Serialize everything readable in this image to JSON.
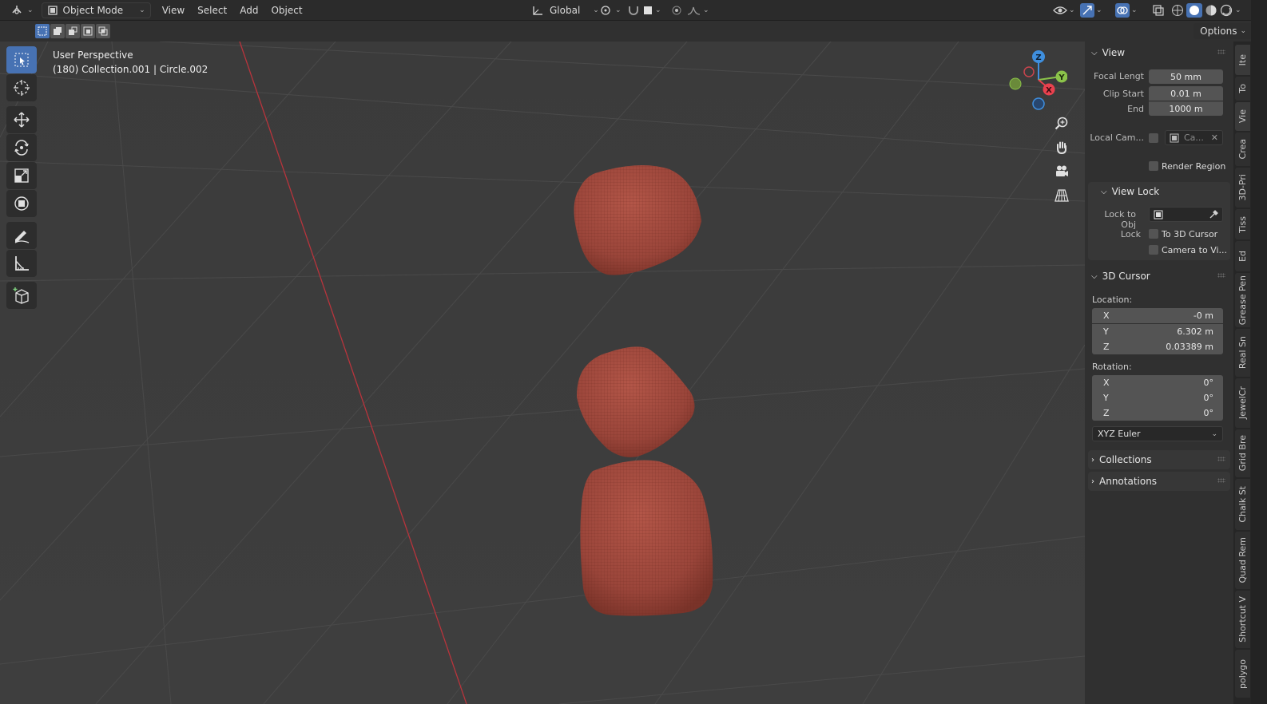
{
  "header": {
    "mode_label": "Object Mode",
    "menu": [
      "View",
      "Select",
      "Add",
      "Object"
    ],
    "orientation_label": "Global"
  },
  "toolbar_options_label": "Options",
  "viewport": {
    "perspective_label": "User Perspective",
    "object_info": "(180) Collection.001 | Circle.002"
  },
  "gizmo": {
    "z": "Z",
    "y": "Y",
    "x": "X"
  },
  "npanel": {
    "view": {
      "title": "View",
      "focal_length_label": "Focal Lengt",
      "focal_length_value": "50 mm",
      "clip_start_label": "Clip Start",
      "clip_start_value": "0.01 m",
      "clip_end_label": "End",
      "clip_end_value": "1000 m",
      "local_camera_label": "Local Cam...",
      "local_camera_value": "Ca...",
      "render_region_label": "Render Region",
      "view_lock_title": "View Lock",
      "lock_to_obj_label": "Lock to Obj",
      "lock_label": "Lock",
      "to_3d_cursor_label": "To 3D Cursor",
      "camera_to_view_label": "Camera to Vi..."
    },
    "cursor": {
      "title": "3D Cursor",
      "location_label": "Location:",
      "loc": [
        {
          "axis": "X",
          "value": "-0 m"
        },
        {
          "axis": "Y",
          "value": "6.302 m"
        },
        {
          "axis": "Z",
          "value": "0.03389 m"
        }
      ],
      "rotation_label": "Rotation:",
      "rot": [
        {
          "axis": "X",
          "value": "0°"
        },
        {
          "axis": "Y",
          "value": "0°"
        },
        {
          "axis": "Z",
          "value": "0°"
        }
      ],
      "rotation_mode": "XYZ Euler"
    },
    "collections_title": "Collections",
    "annotations_title": "Annotations"
  },
  "tabs": [
    "Ite",
    "To",
    "Vie",
    "Crea",
    "3D-Pri",
    "Tiss",
    "Ed",
    "Grease Pen",
    "Real Sn",
    "JewelCr",
    "Grid Bre",
    "Chalk St",
    "Quad Rem",
    "Shortcut V",
    "polygo"
  ],
  "colors": {
    "accent": "#4772b3",
    "object_red": "#a0493e",
    "x_axis": "#e8414e",
    "y_axis": "#8bc34a",
    "z_axis": "#3f8fde"
  }
}
